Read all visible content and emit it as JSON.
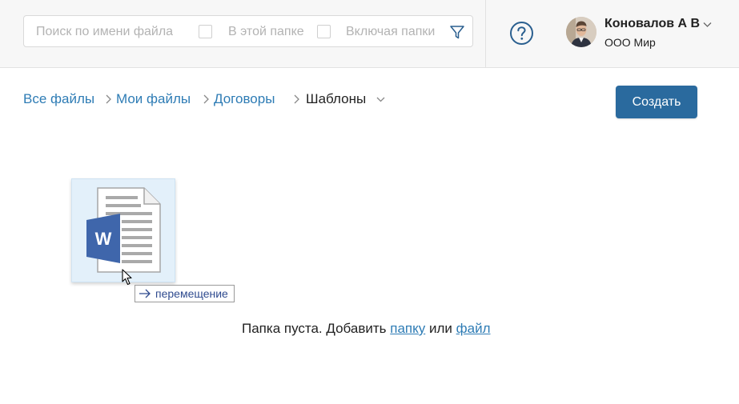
{
  "header": {
    "search": {
      "placeholder": "Поиск по имени файла",
      "value": "",
      "in_folder_label": "В этой папке",
      "include_subfolders_label": "Включая папки"
    },
    "icons": {
      "filter": "filter-icon",
      "help": "help-circle-icon"
    },
    "user": {
      "name": "Коновалов А В",
      "company": "ООО Мир"
    }
  },
  "breadcrumb": {
    "items": [
      "Все файлы",
      "Мои файлы",
      "Договоры"
    ],
    "current": "Шаблоны"
  },
  "toolbar": {
    "create_label": "Создать"
  },
  "file": {
    "icon": "word-document-icon",
    "letter": "W"
  },
  "drag": {
    "tooltip_label": "перемещение",
    "icon": "arrow-right-icon"
  },
  "empty": {
    "prefix": "Папка пуста. Добавить",
    "folder_link": "папку",
    "or": "или",
    "file_link": "файл"
  },
  "colors": {
    "accent": "#2a6a9e",
    "link": "#2e7cb5",
    "word": "#3f66ab"
  }
}
